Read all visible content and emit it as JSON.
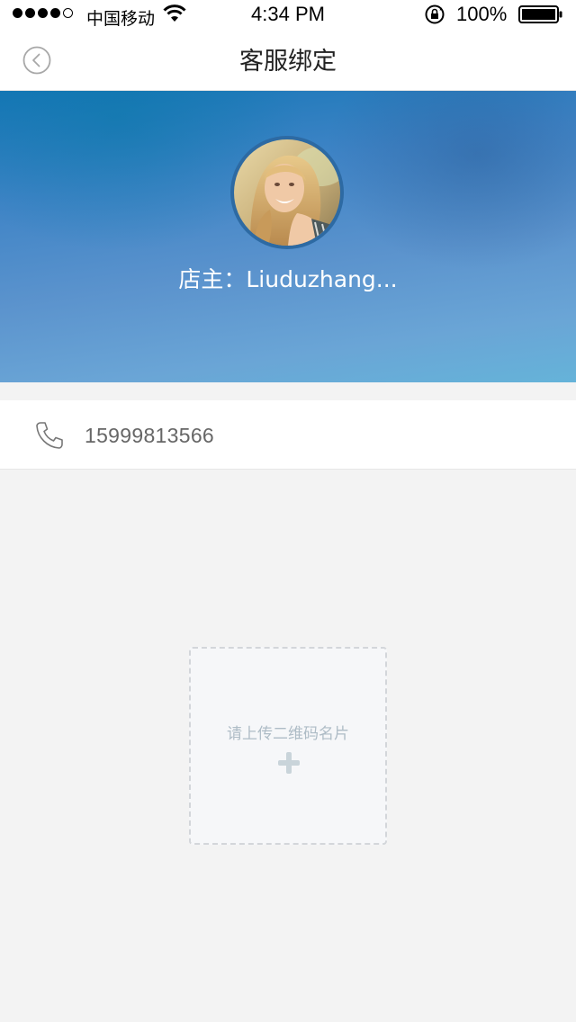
{
  "status_bar": {
    "carrier": "中国移动",
    "time": "4:34 PM",
    "battery": "100%"
  },
  "nav": {
    "title": "客服绑定",
    "back_icon": "chevron-left-circle-icon"
  },
  "profile": {
    "owner_text": "店主：Liuduzhang...",
    "avatar": "avatar-photo"
  },
  "contact": {
    "phone_icon": "phone-icon",
    "phone_number": "15999813566"
  },
  "upload": {
    "label": "请上传二维码名片",
    "icon": "plus-icon"
  },
  "colors": {
    "hero_top": "#1576b6",
    "hero_bottom": "#65b3d9",
    "page_bg": "#f3f3f3",
    "upload_text": "#aebcc6"
  }
}
